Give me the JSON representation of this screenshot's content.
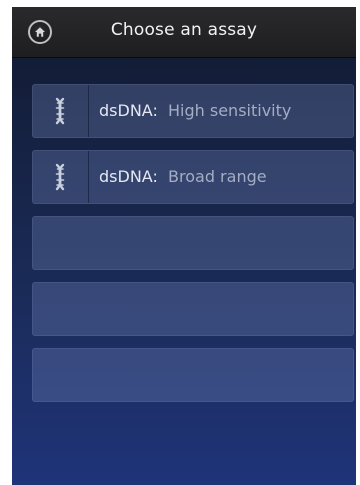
{
  "header": {
    "title": "Choose an assay",
    "home_icon": "home-icon"
  },
  "assays": [
    {
      "kind": "dsDNA:",
      "name": "High sensitivity",
      "icon": "dna-icon"
    },
    {
      "kind": "dsDNA:",
      "name": "Broad range",
      "icon": "dna-icon"
    }
  ],
  "empty_slots": 3,
  "colors": {
    "header_bg": "#1e1e20",
    "background_top": "#10192e",
    "background_bottom": "#1f3479",
    "primary_text": "#e4e8f2",
    "secondary_text": "#a4adc4"
  }
}
